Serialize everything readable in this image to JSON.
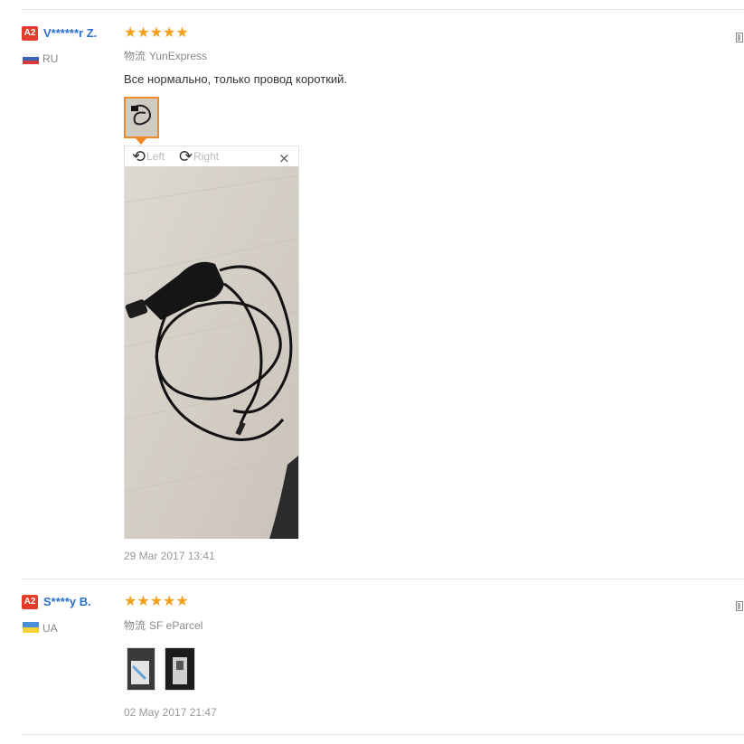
{
  "reviews": [
    {
      "badge": "A2",
      "username": "V******r Z.",
      "country": "RU",
      "stars": "★★★★★",
      "logistics_label": "物流",
      "logistics_value": "YunExpress",
      "text": "Все нормально, только провод короткий.",
      "viewer": {
        "left_icon": "⟲",
        "left_label": "Left",
        "right_icon": "⟳",
        "right_label": "Right",
        "close": "×"
      },
      "date": "29 Mar 2017 13:41"
    },
    {
      "badge": "A2",
      "username": "S****y B.",
      "country": "UA",
      "stars": "★★★★★",
      "logistics_label": "物流",
      "logistics_value": "SF eParcel",
      "text": "",
      "date": "02 May 2017 21:47"
    }
  ],
  "colors": {
    "badge": "#e43b2c",
    "username": "#2a6fc9",
    "star": "#f5a01a",
    "active_thumb": "#f08a24"
  }
}
